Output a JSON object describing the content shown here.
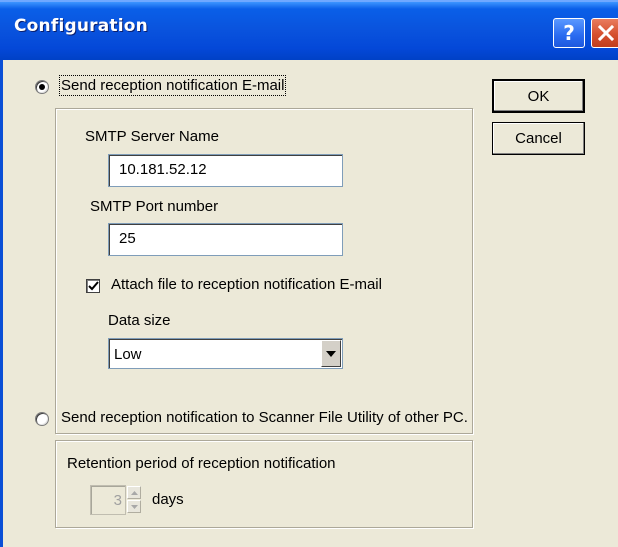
{
  "window": {
    "title": "Configuration",
    "help_icon": "question-icon",
    "close_icon": "close-x-icon"
  },
  "email_option": {
    "label": "Send reception notification E-mail",
    "selected": true
  },
  "smtp": {
    "server_label": "SMTP Server Name",
    "server_value": "10.181.52.12",
    "port_label": "SMTP Port number",
    "port_value": "25"
  },
  "attach": {
    "label": "Attach file to reception notification E-mail",
    "checked": true
  },
  "data_size": {
    "label": "Data size",
    "value": "Low"
  },
  "scanner_option": {
    "label": "Send reception notification to Scanner File Utility of other PC.",
    "selected": false
  },
  "retention": {
    "label": "Retention period of reception notification",
    "value": "3",
    "unit": "days",
    "enabled": false
  },
  "buttons": {
    "ok": "OK",
    "cancel": "Cancel"
  },
  "colors": {
    "titlebar": "#0a54de",
    "dialog_bg": "#ece9d8",
    "close_button": "#d5502f"
  }
}
